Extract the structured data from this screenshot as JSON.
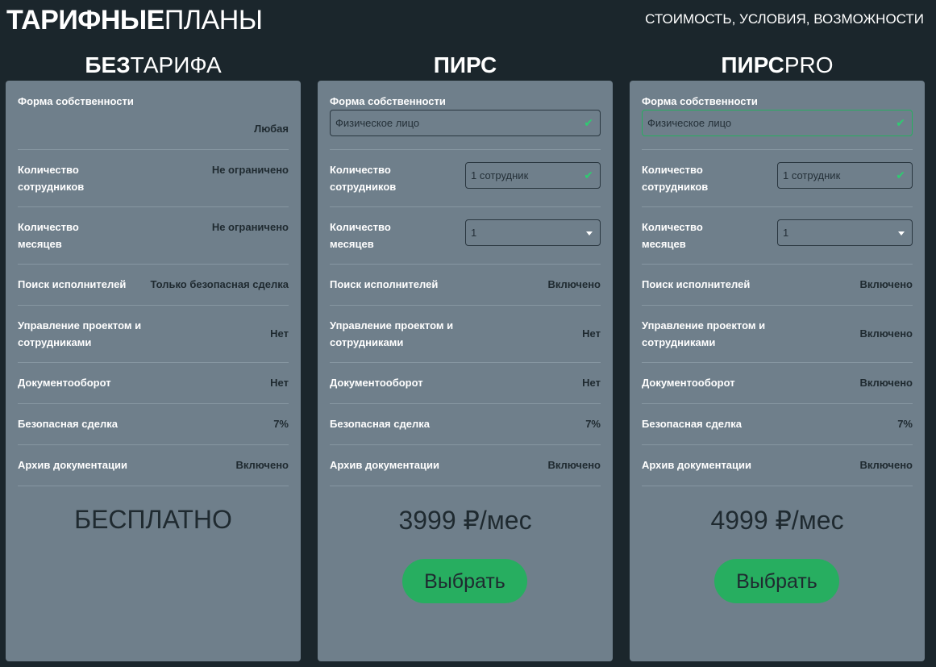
{
  "header": {
    "title_bold": "ТАРИФНЫЕ",
    "title_light": "ПЛАНЫ",
    "subtitle": "СТОИМОСТЬ, УСЛОВИЯ, ВОЗМОЖНОСТИ"
  },
  "row_labels": {
    "ownership": "Форма собственности",
    "employees": "Количество сотрудников",
    "months": "Количество месяцев",
    "search": "Поиск исполнителей",
    "project": "Управление проектом и сотрудниками",
    "docflow": "Документооборот",
    "safe_deal": "Безопасная сделка",
    "archive": "Архив документации"
  },
  "plans": [
    {
      "name_bold": "БЕЗ",
      "name_light": "ТАРИФА",
      "ownership": "Любая",
      "employees": "Не ограничено",
      "months": "Не ограничено",
      "search": "Только безопасная сделка",
      "project": "Нет",
      "docflow": "Нет",
      "safe_deal": "7%",
      "archive": "Включено",
      "price": "БЕСПЛАТНО"
    },
    {
      "name_bold": "ПИРС",
      "name_light": "",
      "ownership_value": "Физическое лицо",
      "employees_value": "1 сотрудник",
      "months_value": "1",
      "search": "Включено",
      "project": "Нет",
      "docflow": "Нет",
      "safe_deal": "7%",
      "archive": "Включено",
      "price": "3999 ₽/мес",
      "button": "Выбрать"
    },
    {
      "name_bold": "ПИРС",
      "name_light": "PRO",
      "ownership_value": "Физическое лицо",
      "employees_value": "1 сотрудник",
      "months_value": "1",
      "search": "Включено",
      "project": "Включено",
      "docflow": "Включено",
      "safe_deal": "7%",
      "archive": "Включено",
      "price": "4999 ₽/мес",
      "button": "Выбрать"
    }
  ],
  "colors": {
    "background": "#1b262c",
    "card": "#6f7f8b",
    "accent": "#27ae60"
  },
  "icons": {
    "valid": "check-icon",
    "dropdown": "chevron-down-icon"
  }
}
